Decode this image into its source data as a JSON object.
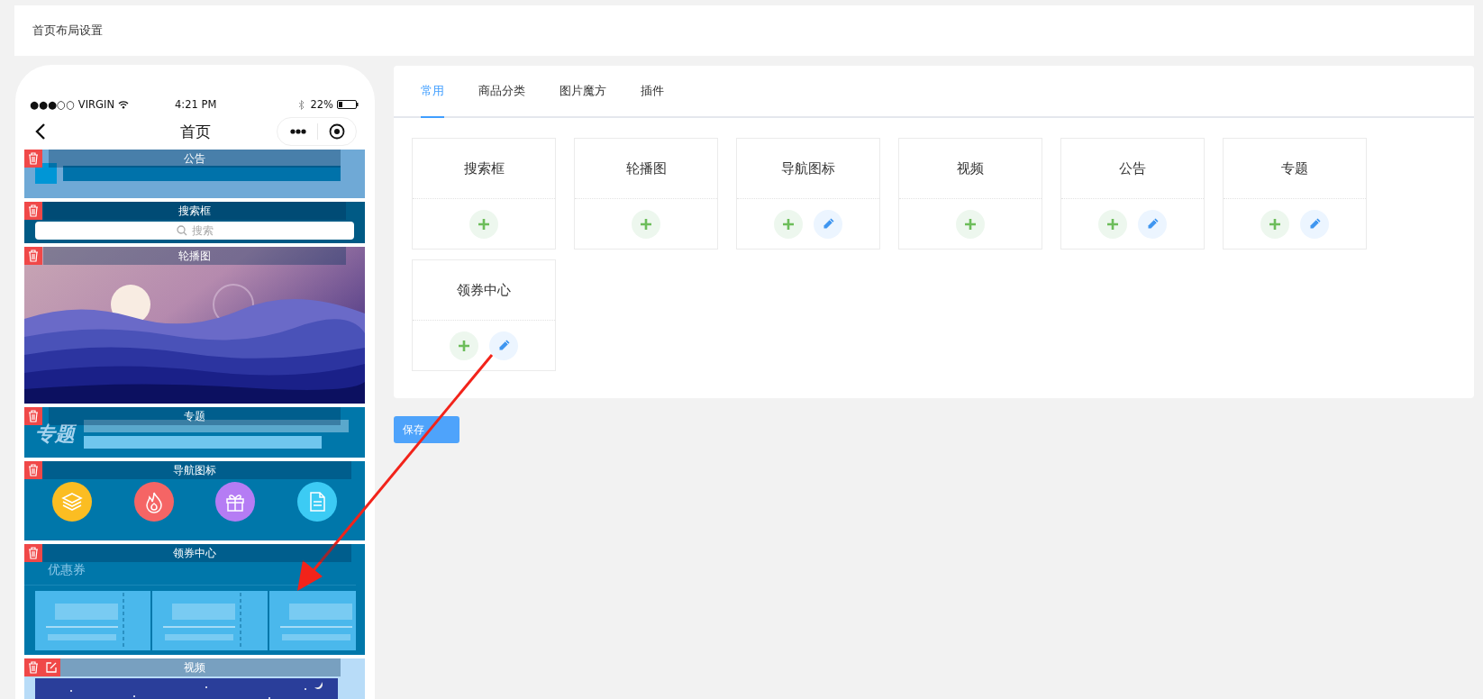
{
  "page_title": "首页布局设置",
  "phone": {
    "status": {
      "carrier": "●●●○○ VIRGIN",
      "time": "4:21 PM",
      "battery": "22%"
    },
    "nav_title": "首页",
    "modules": [
      {
        "kind": "notice",
        "title": "公告",
        "editable": false
      },
      {
        "kind": "search",
        "title": "搜索框",
        "editable": false,
        "placeholder": "搜索"
      },
      {
        "kind": "carousel",
        "title": "轮播图",
        "editable": false
      },
      {
        "kind": "topic",
        "title": "专题",
        "editable": false,
        "label": "专题"
      },
      {
        "kind": "nav",
        "title": "导航图标",
        "editable": false,
        "icons": [
          {
            "color": "#fbbd22"
          },
          {
            "color": "#f56565"
          },
          {
            "color": "#b57cf4"
          },
          {
            "color": "#3ccbf4"
          }
        ]
      },
      {
        "kind": "coupon",
        "title": "领券中心",
        "editable": false,
        "label": "优惠券"
      },
      {
        "kind": "video",
        "title": "视频",
        "editable": true
      }
    ]
  },
  "tabs": [
    {
      "label": "常用",
      "selected": true
    },
    {
      "label": "商品分类",
      "selected": false
    },
    {
      "label": "图片魔方",
      "selected": false
    },
    {
      "label": "插件",
      "selected": false
    }
  ],
  "widgets": [
    {
      "title": "搜索框",
      "editable": false
    },
    {
      "title": "轮播图",
      "editable": false
    },
    {
      "title": "导航图标",
      "editable": true
    },
    {
      "title": "视频",
      "editable": false
    },
    {
      "title": "公告",
      "editable": true
    },
    {
      "title": "专题",
      "editable": true
    },
    {
      "title": "领券中心",
      "editable": true
    }
  ],
  "save_button": "保存"
}
